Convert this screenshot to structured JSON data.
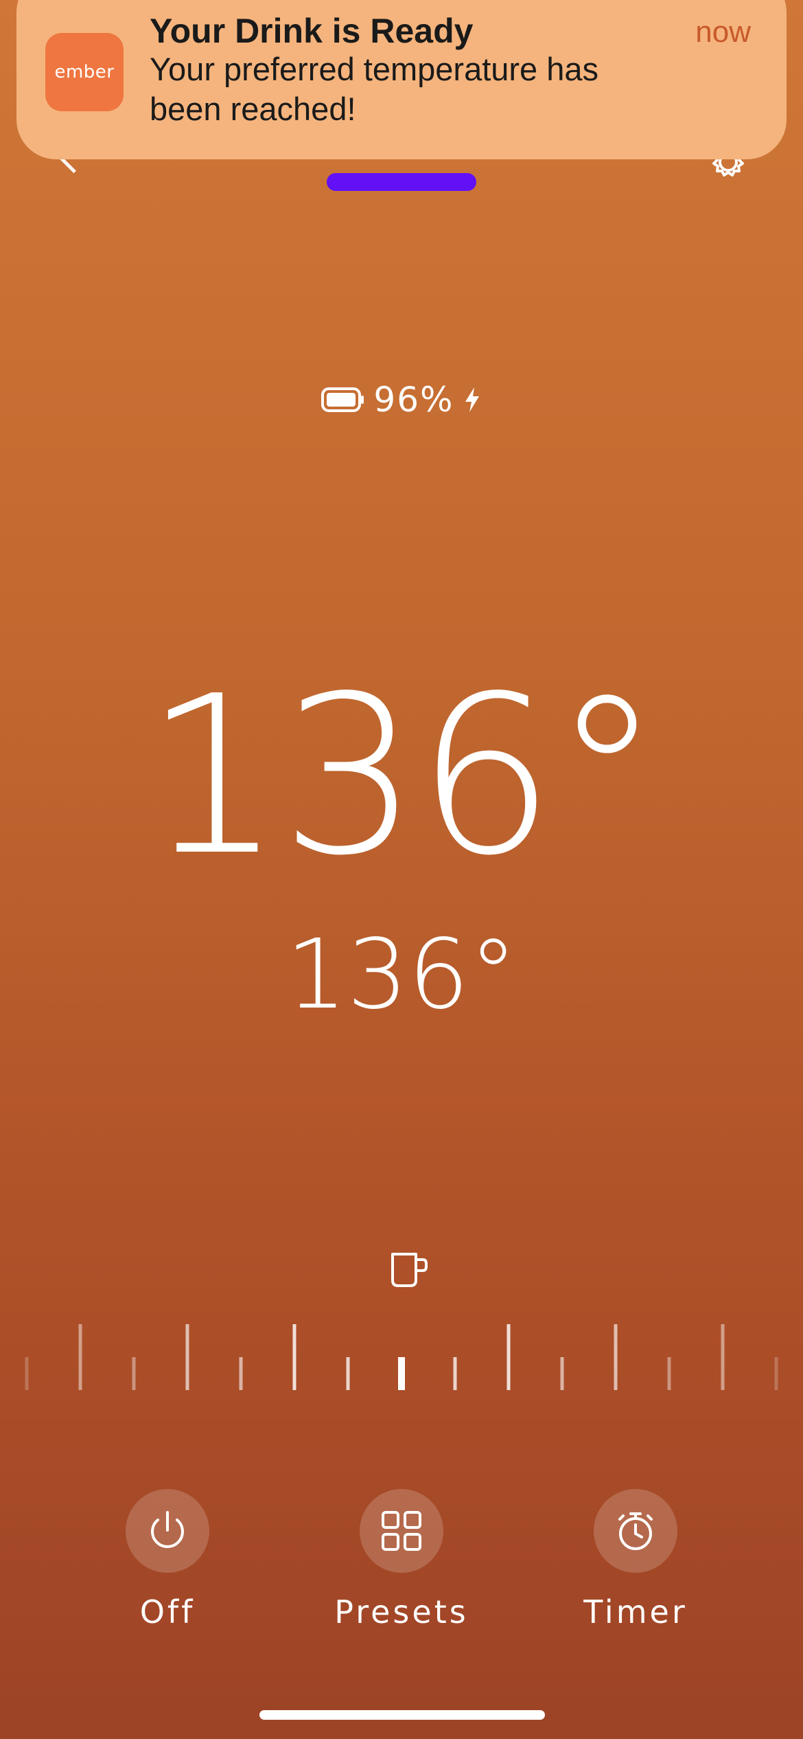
{
  "notification": {
    "app_icon_text": "ember",
    "title": "Your Drink is Ready",
    "time": "now",
    "body": "Your preferred temperature has been reached!"
  },
  "battery": {
    "percent_text": "96%",
    "charging": true
  },
  "temperature": {
    "current": "136°",
    "target": "136°"
  },
  "controls": {
    "off_label": "Off",
    "presets_label": "Presets",
    "timer_label": "Timer"
  },
  "colors": {
    "background_top": "#cf7738",
    "background_bottom": "#9d4326",
    "notification_bg": "#f5b47d",
    "app_icon_bg": "#ef7640",
    "device_pill": "#6211f7"
  },
  "icons": {
    "nav": [
      "back-chevron-icon",
      "gear-icon"
    ],
    "status": [
      "battery-icon",
      "charging-bolt-icon"
    ],
    "slider": "mug-icon",
    "controls": [
      "power-icon",
      "grid-icon",
      "stopwatch-icon"
    ]
  }
}
